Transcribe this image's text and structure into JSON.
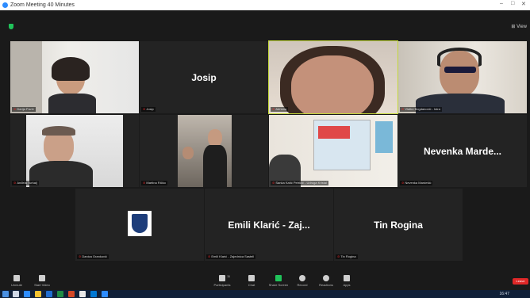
{
  "window": {
    "title": "Zoom Meeting 40 Minutes",
    "minimize": "–",
    "maximize": "□",
    "close": "✕"
  },
  "topbar": {
    "view_label": "⊞ View"
  },
  "tiles": {
    "t1": {
      "label": "Darija Pavić"
    },
    "josip": {
      "name": "Josip",
      "label": "Josip"
    },
    "t3": {
      "label": "Adriana"
    },
    "t4": {
      "label": "Vlatko Bogdanović - Istra"
    },
    "t5": {
      "label": "Anđela Turkalj"
    },
    "t6": {
      "label": "Martina Ričko"
    },
    "t7": {
      "label": "Sanka Katić Petričić - Udruga Kristal"
    },
    "nevenka": {
      "name": "Nevenka Marde...",
      "label": "Nevenka Mardešić"
    },
    "t9": {
      "label": "Danica Granković"
    },
    "emili": {
      "name": "Emili Klarić - Zaj...",
      "label": "Emili Klarić - Zajednica Sastell"
    },
    "tin": {
      "name": "Tin Rogina",
      "label": "Tin Rogina"
    }
  },
  "toolbar": {
    "unmute": "Unmute",
    "start_video": "Start Video",
    "participants": "Participants",
    "participants_count": "11",
    "chat": "Chat",
    "share_screen": "Share Screen",
    "record": "Record",
    "reactions": "Reactions",
    "apps": "Apps",
    "end": "Leave"
  },
  "taskbar": {
    "time": "16:47"
  },
  "colors": {
    "active_speaker": "#c3d83a",
    "end_red": "#e02828",
    "share_green": "#20c35a",
    "zoom_blue": "#2d8cff"
  }
}
